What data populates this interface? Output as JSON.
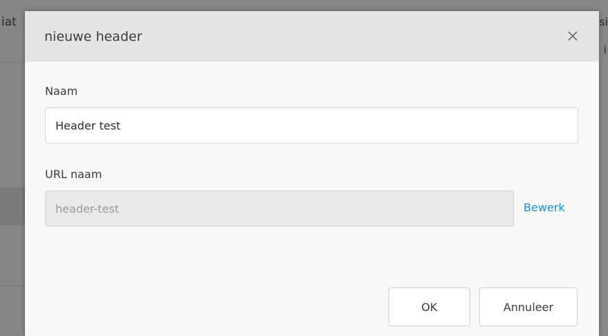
{
  "background": {
    "left_text": "iat",
    "right_text_top": "si",
    "right_text_mid": "i"
  },
  "dialog": {
    "title": "nieuwe header",
    "close_icon": "close-icon",
    "fields": {
      "naam": {
        "label": "Naam",
        "value": "Header test"
      },
      "url_naam": {
        "label": "URL naam",
        "value": "header-test",
        "edit_link": "Bewerk"
      }
    },
    "buttons": {
      "ok": "OK",
      "cancel": "Annuleer"
    }
  },
  "colors": {
    "link": "#1b8fde",
    "header_bg": "#e4e4e4",
    "dialog_bg": "#f8f8f8",
    "disabled_input_bg": "#e9e9e9"
  }
}
